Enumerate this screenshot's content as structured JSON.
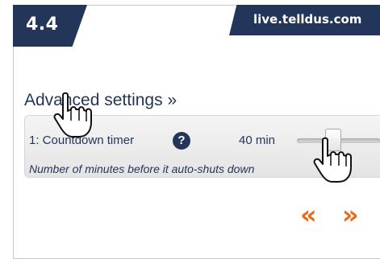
{
  "step": "4.4",
  "domain": "live.telldus.com",
  "advanced_link": "Advanced settings »",
  "setting": {
    "label": "1: Countdown timer",
    "value": "40 min",
    "description": "Number of minutes before it auto-shuts down"
  },
  "icons": {
    "help": "?",
    "prev": "«",
    "next": "»",
    "cursor": "pointing-hand-icon"
  },
  "colors": {
    "navy": "#23365a",
    "accent": "#ea6a18"
  }
}
